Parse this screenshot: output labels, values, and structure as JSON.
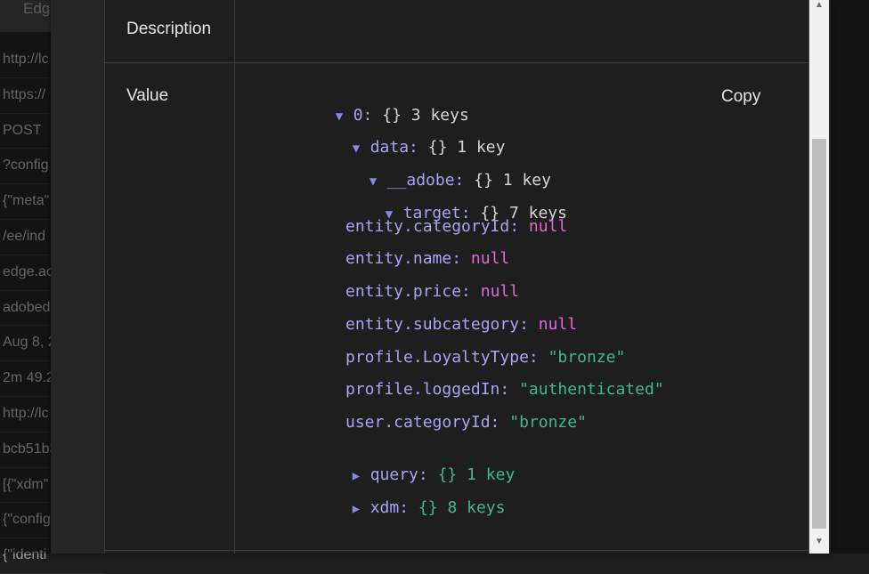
{
  "background": {
    "tab_label": "Edg",
    "rows": [
      "http://lc",
      "https://",
      "POST",
      "?config",
      "{\"meta\"",
      "/ee/ind",
      "edge.ac",
      "adobed",
      "Aug 8, 2",
      "2m 49.2",
      "http://lc",
      "bcb51b3",
      "[{\"xdm\"",
      "{\"config",
      "{\"identi"
    ]
  },
  "modal": {
    "description_label": "Description",
    "value_label": "Value",
    "copy_label": "Copy"
  },
  "tree": {
    "root": {
      "key": "0:",
      "braces": "{}",
      "count": "3 keys"
    },
    "data": {
      "key": "data:",
      "braces": "{}",
      "count": "1 key"
    },
    "adobe": {
      "key": "__adobe:",
      "braces": "{}",
      "count": "1 key"
    },
    "target": {
      "key": "target:",
      "braces": "{}",
      "count": "7 keys"
    },
    "leaves": [
      {
        "key": "entity.categoryId:",
        "value": "null"
      },
      {
        "key": "entity.name:",
        "value": "null"
      },
      {
        "key": "entity.price:",
        "value": "null"
      },
      {
        "key": "entity.subcategory:",
        "value": "null"
      },
      {
        "key": "profile.LoyaltyType:",
        "value": "\"bronze\""
      },
      {
        "key": "profile.loggedIn:",
        "value": "\"authenticated\""
      },
      {
        "key": "user.categoryId:",
        "value": "\"bronze\""
      }
    ],
    "query": {
      "key": "query:",
      "braces": "{}",
      "count": "1 key"
    },
    "xdm": {
      "key": "xdm:",
      "braces": "{}",
      "count": "8 keys"
    }
  },
  "colors": {
    "key": "#a9a4f2",
    "null": "#e067d9",
    "string": "#3fb98a",
    "twisty": "#8888e8"
  },
  "icons": {
    "expanded": "triangle-down-icon",
    "collapsed": "triangle-right-icon"
  }
}
